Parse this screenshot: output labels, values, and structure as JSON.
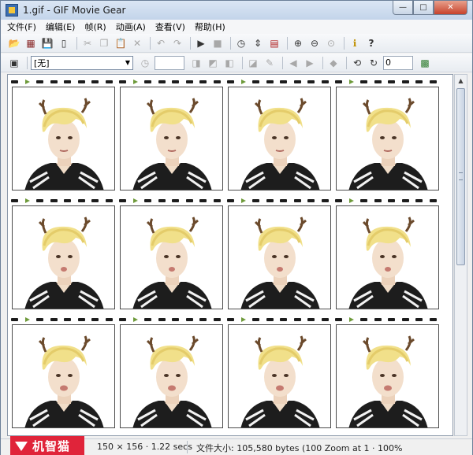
{
  "window": {
    "title": "1.gif - GIF Movie Gear"
  },
  "title_buttons": {
    "minimize": "—",
    "maximize": "□",
    "close": "✕"
  },
  "menu": [
    "文件(F)",
    "编辑(E)",
    "帧(R)",
    "动画(A)",
    "查看(V)",
    "帮助(H)"
  ],
  "toolbar1": {
    "icons": [
      "open-icon",
      "film-icon",
      "save-icon",
      "new-icon",
      "cut-icon",
      "copy-icon",
      "paste-icon",
      "delete-icon",
      "undo-icon",
      "redo-icon",
      "play-icon",
      "stop-icon",
      "clock-icon",
      "resize-icon",
      "crop-icon",
      "zoom-in-icon",
      "zoom-out-icon",
      "zoom-fit-icon",
      "info-icon",
      "help-icon"
    ],
    "help_label": "?"
  },
  "toolbar2": {
    "combo_value": "[无]",
    "delay_value": "",
    "loop_value": "0"
  },
  "filmstrip": {
    "rows": 3,
    "columns": 4,
    "frames": 12
  },
  "colors": {
    "accent": "#3a6db0",
    "close": "#c7432c",
    "watermark": "#e0243a",
    "film_arrow": "#6e9a3a"
  },
  "watermark": {
    "text": "机智猫"
  },
  "status": {
    "left": "150 × 156 · 1.22 secs",
    "right": "文件大小: 105,580 bytes (100 Zoom at 1 · 100%"
  }
}
